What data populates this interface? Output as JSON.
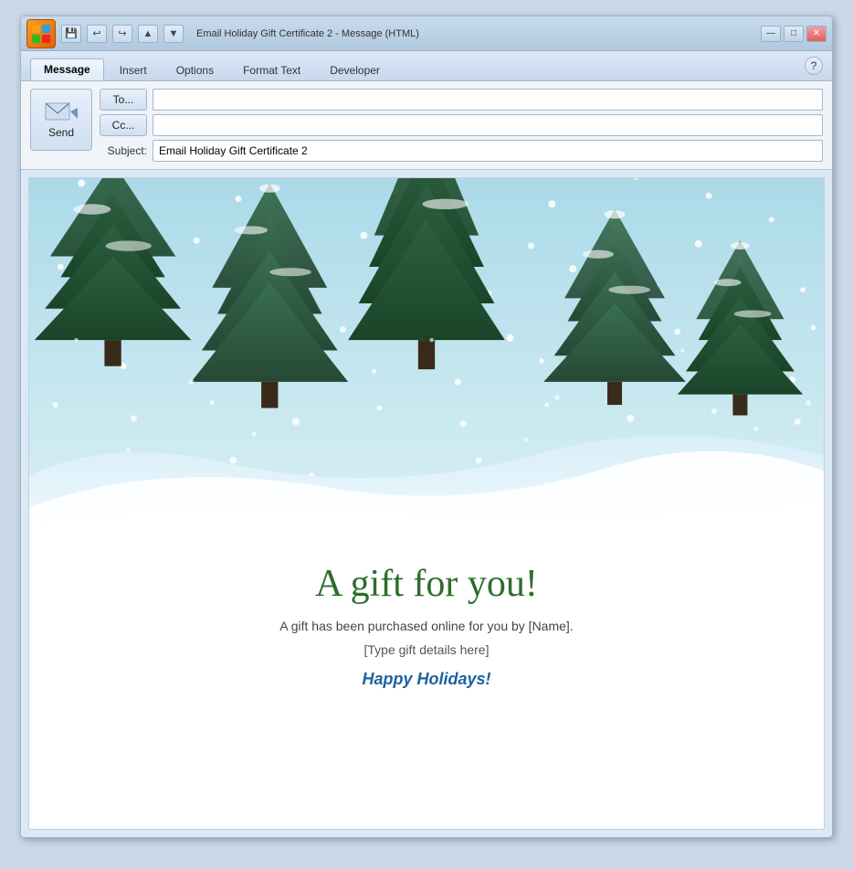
{
  "window": {
    "title": "Email Holiday Gift Certificate 2 - Message (HTML)"
  },
  "titlebar": {
    "logo": "W",
    "controls": {
      "minimize": "—",
      "restore": "□",
      "close": "✕"
    },
    "quickaccess": [
      "💾",
      "↩",
      "↪",
      "▲",
      "▼"
    ]
  },
  "ribbon": {
    "tabs": [
      {
        "label": "Message",
        "active": true
      },
      {
        "label": "Insert",
        "active": false
      },
      {
        "label": "Options",
        "active": false
      },
      {
        "label": "Format Text",
        "active": false
      },
      {
        "label": "Developer",
        "active": false
      }
    ],
    "help_icon": "?"
  },
  "email": {
    "send_label": "Send",
    "to_label": "To...",
    "cc_label": "Cc...",
    "to_value": "",
    "cc_value": "",
    "subject_label": "Subject:",
    "subject_value": "Email Holiday Gift Certificate 2"
  },
  "body": {
    "gift_title": "A gift for you!",
    "gift_subtitle": "A gift has been purchased online for you by [Name].",
    "gift_details": "[Type gift details here]",
    "gift_closing": "Happy Holidays!"
  }
}
